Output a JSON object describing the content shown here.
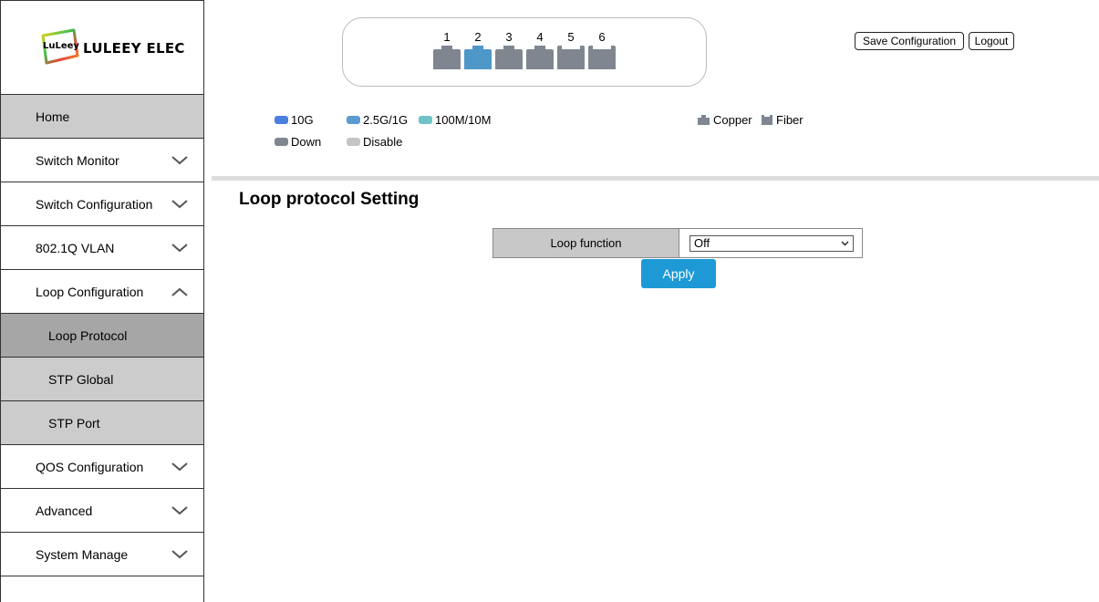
{
  "brand": {
    "badge_text": "LuLeey",
    "name": "LULEEY ELEC"
  },
  "sidebar": {
    "items": [
      {
        "label": "Home",
        "type": "home"
      },
      {
        "label": "Switch Monitor",
        "type": "group",
        "expanded": false
      },
      {
        "label": "Switch Configuration",
        "type": "group",
        "expanded": false
      },
      {
        "label": "802.1Q VLAN",
        "type": "group",
        "expanded": false
      },
      {
        "label": "Loop Configuration",
        "type": "group",
        "expanded": true
      },
      {
        "label": "Loop Protocol",
        "type": "sub",
        "active": true
      },
      {
        "label": "STP Global",
        "type": "sub"
      },
      {
        "label": "STP Port",
        "type": "sub"
      },
      {
        "label": "QOS Configuration",
        "type": "group",
        "expanded": false
      },
      {
        "label": "Advanced",
        "type": "group",
        "expanded": false
      },
      {
        "label": "System Manage",
        "type": "group",
        "expanded": false
      }
    ]
  },
  "ports": [
    {
      "num": "1",
      "kind": "copper",
      "color": "#7f8690"
    },
    {
      "num": "2",
      "kind": "copper",
      "color": "#4e97c9"
    },
    {
      "num": "3",
      "kind": "copper",
      "color": "#7f8690"
    },
    {
      "num": "4",
      "kind": "copper",
      "color": "#7f8690"
    },
    {
      "num": "5",
      "kind": "fiber",
      "color": "#7f8690"
    },
    {
      "num": "6",
      "kind": "fiber",
      "color": "#7f8690"
    }
  ],
  "header": {
    "save_label": "Save Configuration",
    "logout_label": "Logout"
  },
  "legend": {
    "speed_10g": "10G",
    "speed_25g": "2.5G/1G",
    "speed_100m": "100M/10M",
    "down": "Down",
    "disable": "Disable",
    "copper": "Copper",
    "fiber": "Fiber",
    "colors": {
      "10g": "#4a7fe0",
      "25g": "#5b9bd0",
      "100m": "#6ec3c8",
      "down": "#7f8690",
      "disable": "#c4c4c4"
    }
  },
  "main": {
    "title": "Loop protocol Setting",
    "loop_function_label": "Loop function",
    "loop_function_value": "Off",
    "apply_label": "Apply"
  }
}
